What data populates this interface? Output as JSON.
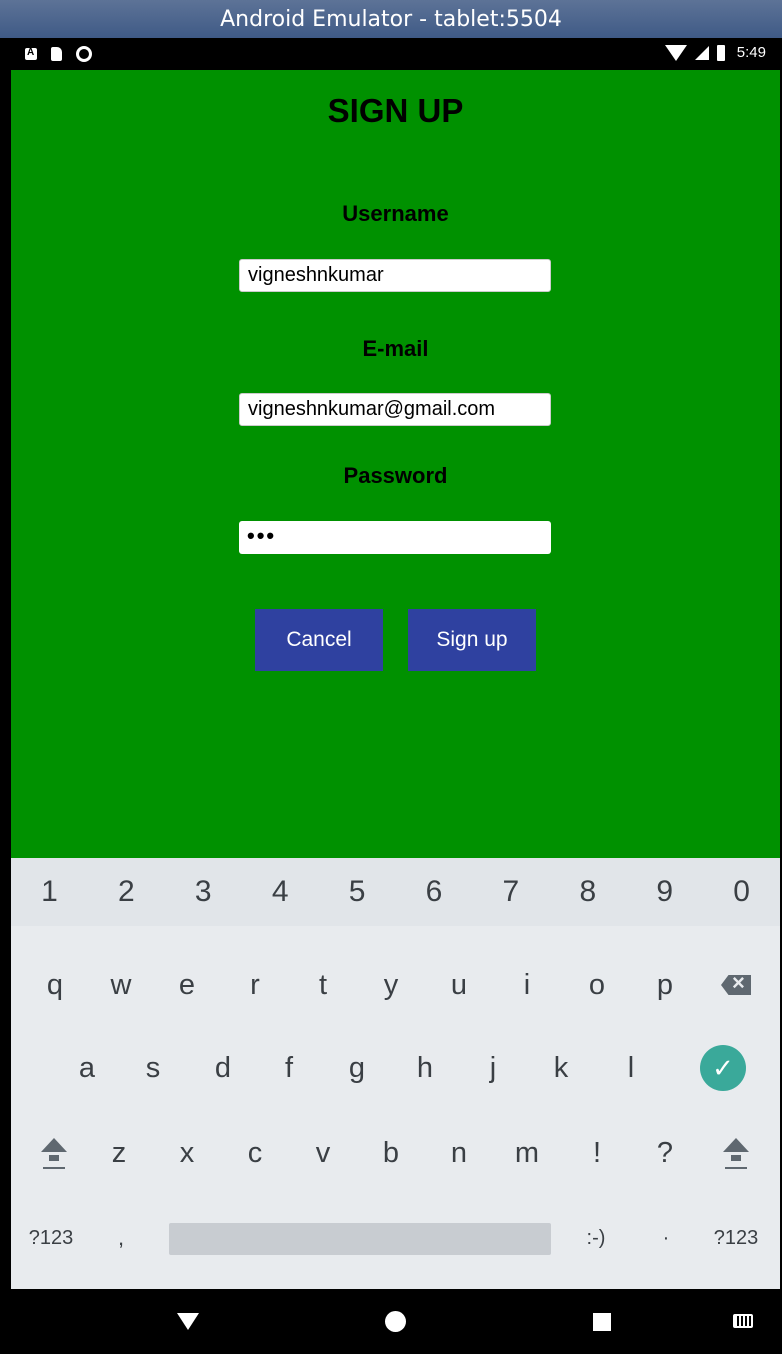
{
  "window": {
    "title": "Android Emulator - tablet:5504"
  },
  "status_bar": {
    "left_icons": [
      "a-notification-icon",
      "sd-card-icon",
      "sync-icon"
    ],
    "right_icons": [
      "wifi-icon",
      "signal-icon",
      "battery-icon"
    ],
    "time": "5:49"
  },
  "app": {
    "background_color": "#009100",
    "title": "SIGN UP",
    "fields": {
      "username": {
        "label": "Username",
        "value": "vigneshnkumar"
      },
      "email": {
        "label": "E-mail",
        "value": "vigneshnkumar@gmail.com"
      },
      "password": {
        "label": "Password",
        "masked_value": "•••"
      }
    },
    "buttons": {
      "cancel": "Cancel",
      "signup": "Sign up",
      "color": "#2f41a0"
    }
  },
  "keyboard": {
    "number_row": [
      "1",
      "2",
      "3",
      "4",
      "5",
      "6",
      "7",
      "8",
      "9",
      "0"
    ],
    "row1": [
      "q",
      "w",
      "e",
      "r",
      "t",
      "y",
      "u",
      "i",
      "o",
      "p"
    ],
    "row2": [
      "a",
      "s",
      "d",
      "f",
      "g",
      "h",
      "j",
      "k",
      "l"
    ],
    "row3": [
      "z",
      "x",
      "c",
      "v",
      "b",
      "n",
      "m",
      "!",
      "?"
    ],
    "bottom": {
      "symbols_left": "?123",
      "comma": ",",
      "emoticon": ":-)",
      "period": "·",
      "symbols_right": "?123"
    },
    "enter_color": "#3aa99a"
  },
  "nav_bar": {
    "icons": [
      "back-icon",
      "home-icon",
      "recents-icon",
      "keyboard-switch-icon"
    ]
  }
}
